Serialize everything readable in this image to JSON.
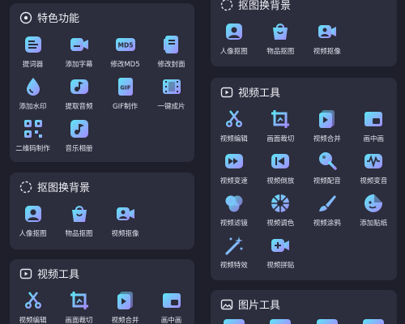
{
  "cards": {
    "features": {
      "title": "特色功能",
      "tools": [
        {
          "label": "提词器",
          "icon": "teleprompter-icon"
        },
        {
          "label": "添加字幕",
          "icon": "subtitle-icon"
        },
        {
          "label": "修改MD5",
          "icon": "md5-icon"
        },
        {
          "label": "修改封面",
          "icon": "cover-icon"
        },
        {
          "label": "添加水印",
          "icon": "watermark-icon"
        },
        {
          "label": "提取音频",
          "icon": "extract-audio-icon"
        },
        {
          "label": "GIF制作",
          "icon": "gif-icon"
        },
        {
          "label": "一键成片",
          "icon": "film-icon"
        },
        {
          "label": "二维码制作",
          "icon": "qrcode-icon"
        },
        {
          "label": "音乐相册",
          "icon": "music-album-icon"
        }
      ]
    },
    "cutout_left": {
      "title": "抠图换背景",
      "tools": [
        {
          "label": "人像抠图",
          "icon": "portrait-icon"
        },
        {
          "label": "物品抠图",
          "icon": "item-bag-icon"
        },
        {
          "label": "视频抠像",
          "icon": "video-cutout-icon"
        }
      ]
    },
    "video_left": {
      "title": "视频工具",
      "tools": [
        {
          "label": "视频编辑",
          "icon": "scissors-icon"
        },
        {
          "label": "画面裁切",
          "icon": "crop-icon"
        },
        {
          "label": "视频合并",
          "icon": "merge-icon"
        },
        {
          "label": "画中画",
          "icon": "pip-icon"
        }
      ]
    },
    "cutout_right": {
      "title": "抠图换背景",
      "tools": [
        {
          "label": "人像抠图",
          "icon": "portrait-icon"
        },
        {
          "label": "物品抠图",
          "icon": "item-bag-icon"
        },
        {
          "label": "视频抠像",
          "icon": "video-cutout-icon"
        }
      ]
    },
    "video_right": {
      "title": "视频工具",
      "tools": [
        {
          "label": "视频编辑",
          "icon": "scissors-icon"
        },
        {
          "label": "画面裁切",
          "icon": "crop-icon"
        },
        {
          "label": "视频合并",
          "icon": "merge-icon"
        },
        {
          "label": "画中画",
          "icon": "pip-icon"
        },
        {
          "label": "视频变速",
          "icon": "speed-icon"
        },
        {
          "label": "视频倒放",
          "icon": "rewind-icon"
        },
        {
          "label": "视频配音",
          "icon": "microphone-icon"
        },
        {
          "label": "视频变音",
          "icon": "voice-change-icon"
        },
        {
          "label": "视频滤镜",
          "icon": "filter-icon"
        },
        {
          "label": "视频调色",
          "icon": "color-wheel-icon"
        },
        {
          "label": "视频涂鸦",
          "icon": "brush-icon"
        },
        {
          "label": "添加贴纸",
          "icon": "sticker-icon"
        },
        {
          "label": "视频特效",
          "icon": "magic-wand-icon"
        },
        {
          "label": "视频拼贴",
          "icon": "collage-icon"
        }
      ]
    },
    "image_right": {
      "title": "图片工具"
    }
  },
  "colors": {
    "background": "#1e1f2b",
    "card": "#2c2d3d",
    "gradient_start": "#5ee6f4",
    "gradient_end": "#a58cff"
  }
}
